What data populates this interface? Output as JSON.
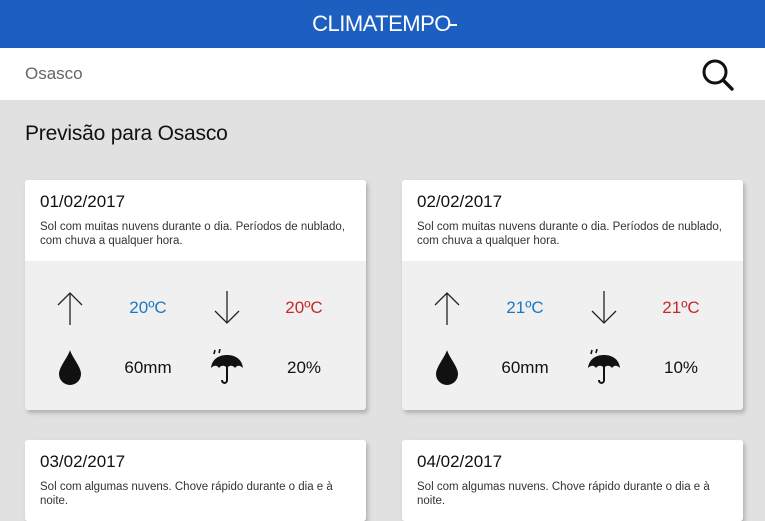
{
  "app": {
    "logo_text": "CLIMATEMPO"
  },
  "search": {
    "value": "",
    "placeholder": "Osasco"
  },
  "page": {
    "title": "Previsão para Osasco"
  },
  "colors": {
    "header": "#1d5fc1",
    "min_temp": "#1b78c4",
    "max_temp": "#c6282b",
    "background": "#e1e1e1"
  },
  "icons": {
    "search": "search-icon",
    "min": "arrow-up-icon",
    "max": "arrow-down-icon",
    "rain": "drop-icon",
    "chance": "umbrella-icon"
  },
  "forecasts": [
    {
      "date": "01/02/2017",
      "description": "Sol com muitas nuvens durante o dia. Períodos de nublado, com chuva a qualquer hora.",
      "min_temp": "20ºC",
      "max_temp": "20ºC",
      "rain": "60mm",
      "rain_chance": "20%"
    },
    {
      "date": "02/02/2017",
      "description": "Sol com muitas nuvens durante o dia. Períodos de nublado, com chuva a qualquer hora.",
      "min_temp": "21ºC",
      "max_temp": "21ºC",
      "rain": "60mm",
      "rain_chance": "10%"
    },
    {
      "date": "03/02/2017",
      "description": "Sol com algumas nuvens. Chove rápido durante o dia e à noite."
    },
    {
      "date": "04/02/2017",
      "description": "Sol com algumas nuvens. Chove rápido durante o dia e à noite."
    }
  ]
}
